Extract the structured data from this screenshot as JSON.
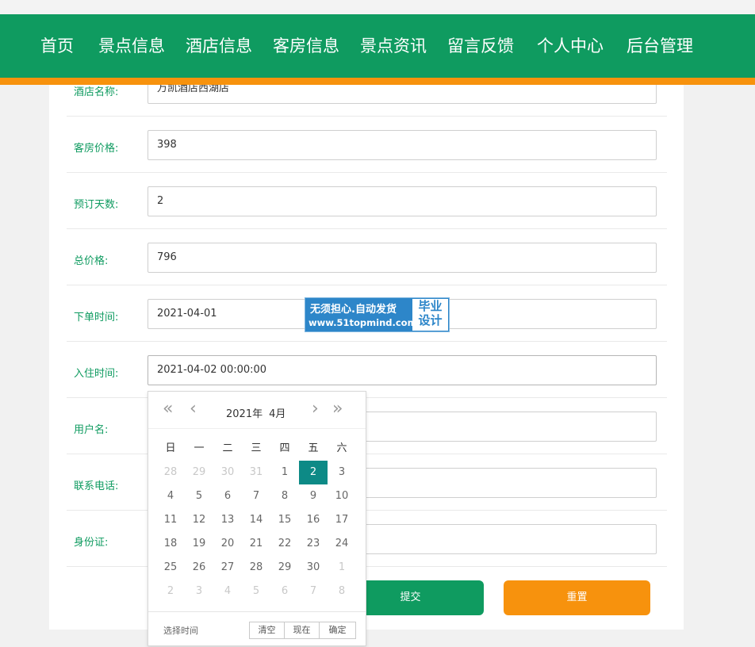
{
  "nav": {
    "items": [
      "首页",
      "景点信息",
      "酒店信息",
      "客房信息",
      "景点资讯",
      "留言反馈",
      "个人中心",
      "后台管理"
    ]
  },
  "form": {
    "fields": [
      {
        "label": "酒店名称:",
        "value": "万凯酒店西湖店"
      },
      {
        "label": "客房价格:",
        "value": "398"
      },
      {
        "label": "预订天数:",
        "value": "2"
      },
      {
        "label": "总价格:",
        "value": "796"
      },
      {
        "label": "下单时间:",
        "value": "2021-04-01"
      },
      {
        "label": "入住时间:",
        "value": "2021-04-02 00:00:00"
      },
      {
        "label": "用户名:",
        "value": ""
      },
      {
        "label": "联系电话:",
        "value": ""
      },
      {
        "label": "身份证:",
        "value": ""
      }
    ],
    "submit_label": "提交",
    "reset_label": "重置"
  },
  "watermark": {
    "line1": "无须担心.自动发货",
    "line2": "www.51topmind.com",
    "side1": "毕业",
    "side2": "设计"
  },
  "datepicker": {
    "year": "2021年",
    "month": "4月",
    "weekdays": [
      "日",
      "一",
      "二",
      "三",
      "四",
      "五",
      "六"
    ],
    "weeks": [
      [
        {
          "d": "28",
          "o": true
        },
        {
          "d": "29",
          "o": true
        },
        {
          "d": "30",
          "o": true
        },
        {
          "d": "31",
          "o": true
        },
        {
          "d": "1"
        },
        {
          "d": "2",
          "s": true
        },
        {
          "d": "3"
        }
      ],
      [
        {
          "d": "4"
        },
        {
          "d": "5"
        },
        {
          "d": "6"
        },
        {
          "d": "7"
        },
        {
          "d": "8"
        },
        {
          "d": "9"
        },
        {
          "d": "10"
        }
      ],
      [
        {
          "d": "11"
        },
        {
          "d": "12"
        },
        {
          "d": "13"
        },
        {
          "d": "14"
        },
        {
          "d": "15"
        },
        {
          "d": "16"
        },
        {
          "d": "17"
        }
      ],
      [
        {
          "d": "18"
        },
        {
          "d": "19"
        },
        {
          "d": "20"
        },
        {
          "d": "21"
        },
        {
          "d": "22"
        },
        {
          "d": "23"
        },
        {
          "d": "24"
        }
      ],
      [
        {
          "d": "25"
        },
        {
          "d": "26"
        },
        {
          "d": "27"
        },
        {
          "d": "28"
        },
        {
          "d": "29"
        },
        {
          "d": "30"
        },
        {
          "d": "1",
          "o": true
        }
      ],
      [
        {
          "d": "2",
          "o": true
        },
        {
          "d": "3",
          "o": true
        },
        {
          "d": "4",
          "o": true
        },
        {
          "d": "5",
          "o": true
        },
        {
          "d": "6",
          "o": true
        },
        {
          "d": "7",
          "o": true
        },
        {
          "d": "8",
          "o": true
        }
      ]
    ],
    "select_time_label": "选择时间",
    "clear_label": "清空",
    "now_label": "现在",
    "confirm_label": "确定",
    "selected_color": "#0d8a86"
  },
  "colors": {
    "brand_green": "#0f9b60",
    "accent_orange": "#f7920d"
  },
  "icons": [
    "double-chevron-left-icon",
    "chevron-left-icon",
    "chevron-right-icon",
    "double-chevron-right-icon"
  ]
}
